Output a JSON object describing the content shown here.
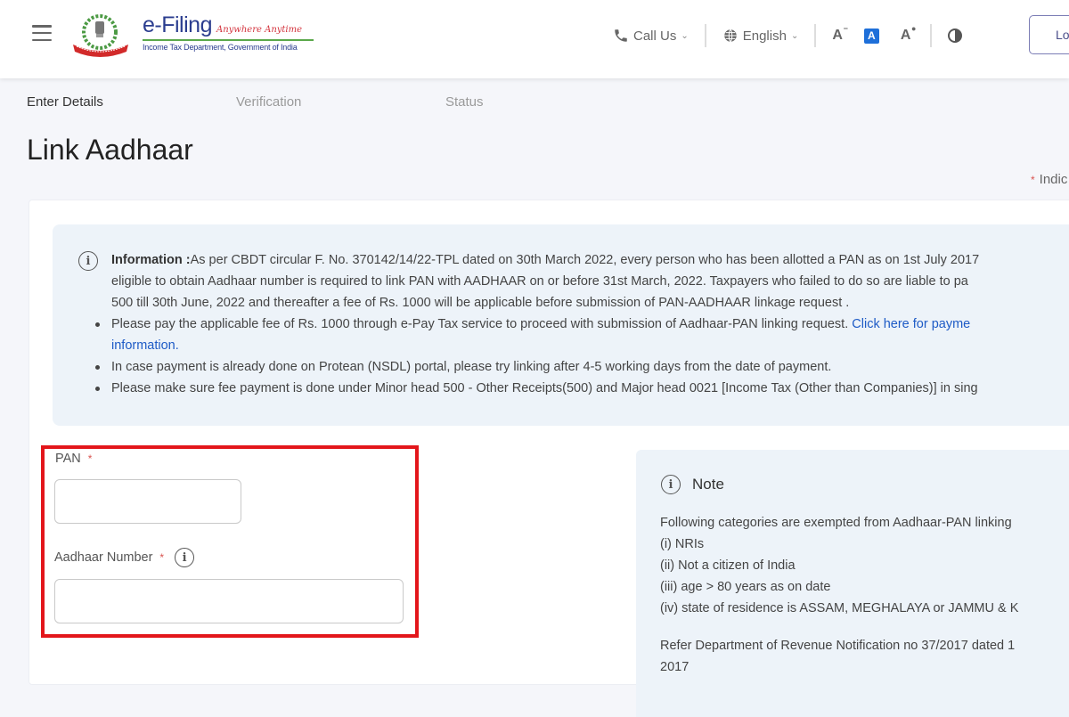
{
  "header": {
    "brand_title": "e-Filing",
    "brand_tagline": "Anywhere Anytime",
    "brand_subtitle": "Income Tax Department, Government of India",
    "call_us": "Call Us",
    "language": "English",
    "font_decrease": "A",
    "font_normal": "A",
    "font_increase": "A",
    "login_label": "Lo",
    "icons": {
      "menu": "hamburger-menu-icon",
      "phone": "phone-icon",
      "globe": "globe-icon",
      "contrast": "contrast-icon"
    }
  },
  "stepper": {
    "steps": [
      {
        "label": "Enter Details",
        "state": "active"
      },
      {
        "label": "Verification",
        "state": "inactive"
      },
      {
        "label": "Status",
        "state": "inactive"
      }
    ]
  },
  "page": {
    "title": "Link Aadhaar",
    "mandatory_note": "Indic"
  },
  "information": {
    "label": "Information :",
    "paragraph": "As per CBDT circular F. No. 370142/14/22-TPL dated on 30th March 2022, every person who has been allotted a PAN as on 1st July 2017",
    "paragraph_line2": "eligible to obtain Aadhaar number is required to link PAN with AADHAAR on or before 31st March, 2022. Taxpayers who failed to do so are liable to pa",
    "paragraph_line3": "500 till 30th June, 2022 and thereafter a fee of Rs. 1000 will be applicable before submission of PAN-AADHAAR linkage request .",
    "bullets": [
      {
        "text": "Please pay the applicable fee of Rs. 1000 through e-Pay Tax service to proceed with submission of Aadhaar-PAN linking request. ",
        "link": "Click here for payme",
        "link_line2": "information."
      },
      {
        "text": "In case payment is already done on Protean (NSDL) portal, please try linking after 4-5 working days from the date of payment."
      },
      {
        "text": "Please make sure fee payment is done under Minor head 500 - Other Receipts(500) and Major head 0021 [Income Tax (Other than Companies)] in sing"
      }
    ]
  },
  "form": {
    "pan": {
      "label": "PAN",
      "required": "*",
      "value": "",
      "placeholder": ""
    },
    "aadhaar": {
      "label": "Aadhaar Number",
      "required": "*",
      "value": "",
      "placeholder": ""
    }
  },
  "note": {
    "title": "Note",
    "intro": "Following categories are exempted from Aadhaar-PAN linking",
    "items": [
      "(i) NRIs",
      "(ii) Not a citizen of India",
      "(iii) age > 80 years as on date",
      "(iv) state of residence is ASSAM, MEGHALAYA or JAMMU & K"
    ],
    "refer": "Refer Department of Revenue Notification no 37/2017 dated 1",
    "refer_line2": "2017"
  },
  "colors": {
    "brand_blue": "#2b3d8f",
    "link_blue": "#1e5bc6",
    "highlight_red": "#e3161b",
    "info_bg": "#edf3f9"
  }
}
